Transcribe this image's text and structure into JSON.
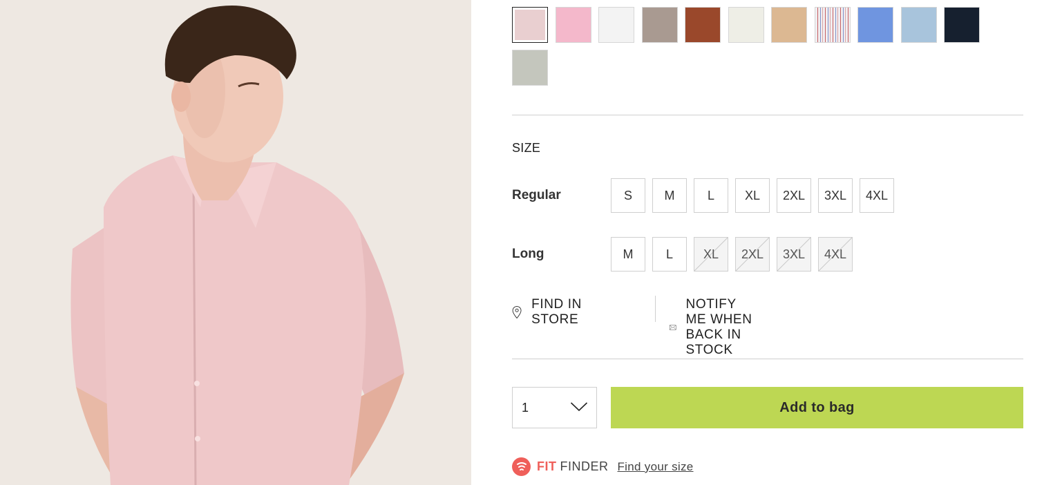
{
  "product_image": {
    "alt": "product-photo",
    "background": "#ece6df",
    "shirt_color": "#efc7c8"
  },
  "colour_swatches": [
    {
      "name": "light-pink",
      "color": "#e9cfd0",
      "selected": true
    },
    {
      "name": "pink",
      "color": "#f4b8cb",
      "selected": false
    },
    {
      "name": "white",
      "color": "#f3f3f3",
      "selected": false
    },
    {
      "name": "taupe",
      "color": "#a99a91",
      "selected": false
    },
    {
      "name": "rust",
      "color": "#9a482b",
      "selected": false
    },
    {
      "name": "cream",
      "color": "#eeeee6",
      "selected": false
    },
    {
      "name": "sand",
      "color": "#dcb892",
      "selected": false
    },
    {
      "name": "stripe",
      "color": "#e9e2e6",
      "selected": false,
      "pattern": "stripe"
    },
    {
      "name": "cornflower-blue",
      "color": "#6f95e0",
      "selected": false
    },
    {
      "name": "sky-blue",
      "color": "#a8c4dc",
      "selected": false
    },
    {
      "name": "navy",
      "color": "#16202f",
      "selected": false
    },
    {
      "name": "sage",
      "color": "#c4c6bd",
      "selected": false
    }
  ],
  "size": {
    "title": "SIZE",
    "rows": [
      {
        "label": "Regular",
        "options": [
          {
            "label": "S",
            "available": true
          },
          {
            "label": "M",
            "available": true
          },
          {
            "label": "L",
            "available": true
          },
          {
            "label": "XL",
            "available": true
          },
          {
            "label": "2XL",
            "available": true
          },
          {
            "label": "3XL",
            "available": true
          },
          {
            "label": "4XL",
            "available": true
          }
        ]
      },
      {
        "label": "Long",
        "options": [
          {
            "label": "M",
            "available": true
          },
          {
            "label": "L",
            "available": true
          },
          {
            "label": "XL",
            "available": false
          },
          {
            "label": "2XL",
            "available": false
          },
          {
            "label": "3XL",
            "available": false
          },
          {
            "label": "4XL",
            "available": false
          }
        ]
      }
    ]
  },
  "links": {
    "find_in_store": "FIND IN STORE",
    "notify": "NOTIFY ME WHEN BACK IN STOCK"
  },
  "purchase": {
    "quantity": "1",
    "add_to_bag": "Add to bag",
    "button_color": "#bdd753"
  },
  "fit_finder": {
    "fit": "FIT",
    "finder": "FINDER",
    "link": "Find your size",
    "brand_color": "#ef5f5a"
  }
}
